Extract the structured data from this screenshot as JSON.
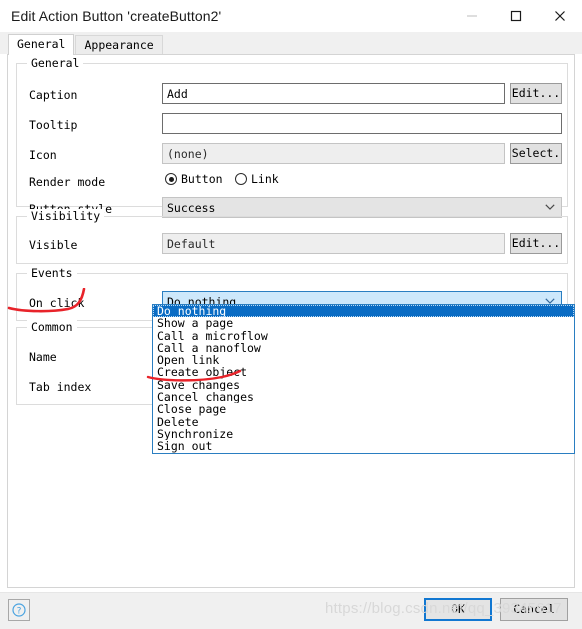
{
  "window": {
    "title": "Edit Action Button 'createButton2'",
    "minimize_label": "Minimize",
    "maximize_label": "Maximize",
    "close_label": "Close"
  },
  "tabs": [
    {
      "label": "General",
      "active": true
    },
    {
      "label": "Appearance",
      "active": false
    }
  ],
  "groups": {
    "general": {
      "title": "General",
      "caption": {
        "label": "Caption",
        "value": "Add",
        "button": "Edit..."
      },
      "tooltip": {
        "label": "Tooltip",
        "value": "",
        "placeholder": ""
      },
      "icon": {
        "label": "Icon",
        "value": "(none)",
        "button": "Select."
      },
      "render_mode": {
        "label": "Render mode",
        "options": [
          {
            "label": "Button",
            "selected": true
          },
          {
            "label": "Link",
            "selected": false
          }
        ]
      },
      "button_style": {
        "label": "Button style",
        "value": "Success"
      }
    },
    "visibility": {
      "title": "Visibility",
      "visible": {
        "label": "Visible",
        "value": "Default",
        "button": "Edit..."
      }
    },
    "events": {
      "title": "Events",
      "on_click": {
        "label": "On click",
        "value": "Do nothing"
      }
    },
    "common": {
      "title": "Common",
      "name": {
        "label": "Name",
        "value": ""
      },
      "tab_index": {
        "label": "Tab index",
        "value": ""
      }
    }
  },
  "dropdown": {
    "open": true,
    "selected_index": 0,
    "items": [
      "Do nothing",
      "Show a page",
      "Call a microflow",
      "Call a nanoflow",
      "Open link",
      "Create object",
      "Save changes",
      "Cancel changes",
      "Close page",
      "Delete",
      "Synchronize",
      "Sign out"
    ]
  },
  "footer": {
    "help_label": "?",
    "ok_label": "OK",
    "cancel_label": "Cancel"
  },
  "watermark": {
    "text": "https://blog.csdn.net/qq_39345617"
  },
  "annotations": {
    "on_click_mark": "red-underline-hook",
    "create_object_mark": "red-underline"
  },
  "colors": {
    "accent": "#0a6cc4",
    "focus_border": "#2a7ec1",
    "focus_fill": "#cde8fb",
    "annotation": "#e8232a",
    "panel_bg": "#ffffff",
    "chrome_bg": "#f0f0f0"
  }
}
